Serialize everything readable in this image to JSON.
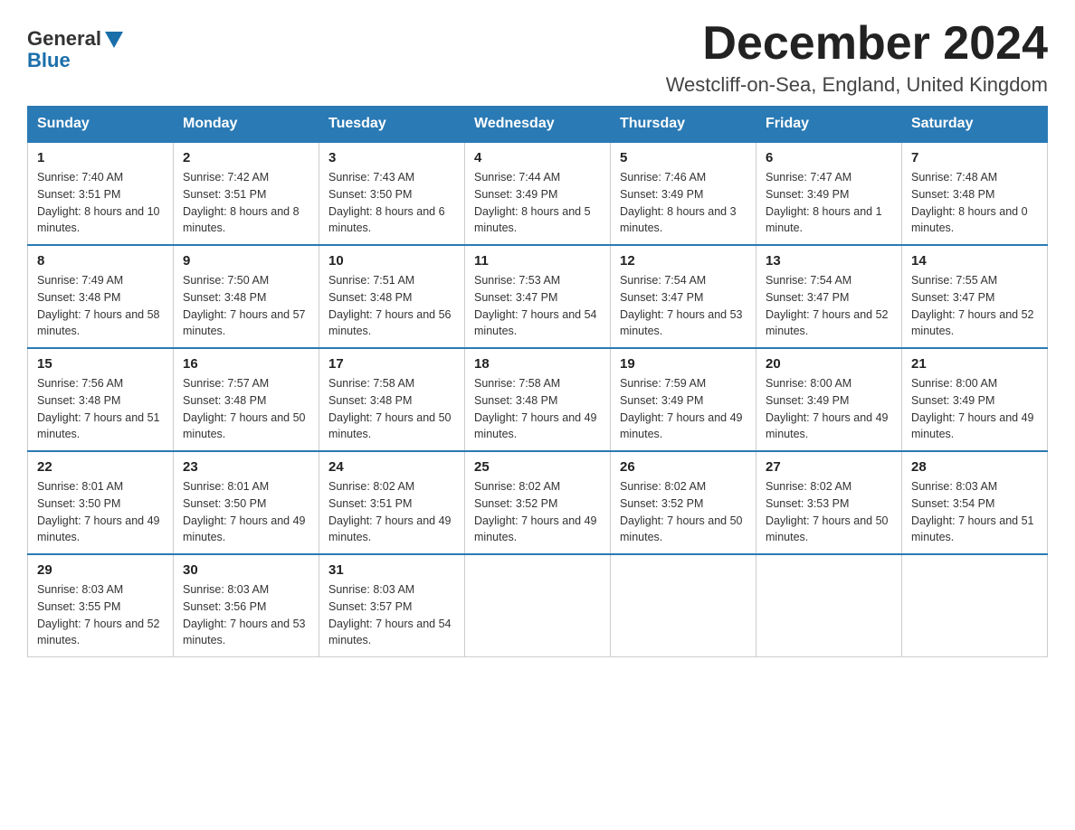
{
  "header": {
    "logo_general": "General",
    "logo_blue": "Blue",
    "month_title": "December 2024",
    "location": "Westcliff-on-Sea, England, United Kingdom"
  },
  "days_of_week": [
    "Sunday",
    "Monday",
    "Tuesday",
    "Wednesday",
    "Thursday",
    "Friday",
    "Saturday"
  ],
  "weeks": [
    [
      {
        "day": "1",
        "sunrise": "7:40 AM",
        "sunset": "3:51 PM",
        "daylight": "8 hours and 10 minutes."
      },
      {
        "day": "2",
        "sunrise": "7:42 AM",
        "sunset": "3:51 PM",
        "daylight": "8 hours and 8 minutes."
      },
      {
        "day": "3",
        "sunrise": "7:43 AM",
        "sunset": "3:50 PM",
        "daylight": "8 hours and 6 minutes."
      },
      {
        "day": "4",
        "sunrise": "7:44 AM",
        "sunset": "3:49 PM",
        "daylight": "8 hours and 5 minutes."
      },
      {
        "day": "5",
        "sunrise": "7:46 AM",
        "sunset": "3:49 PM",
        "daylight": "8 hours and 3 minutes."
      },
      {
        "day": "6",
        "sunrise": "7:47 AM",
        "sunset": "3:49 PM",
        "daylight": "8 hours and 1 minute."
      },
      {
        "day": "7",
        "sunrise": "7:48 AM",
        "sunset": "3:48 PM",
        "daylight": "8 hours and 0 minutes."
      }
    ],
    [
      {
        "day": "8",
        "sunrise": "7:49 AM",
        "sunset": "3:48 PM",
        "daylight": "7 hours and 58 minutes."
      },
      {
        "day": "9",
        "sunrise": "7:50 AM",
        "sunset": "3:48 PM",
        "daylight": "7 hours and 57 minutes."
      },
      {
        "day": "10",
        "sunrise": "7:51 AM",
        "sunset": "3:48 PM",
        "daylight": "7 hours and 56 minutes."
      },
      {
        "day": "11",
        "sunrise": "7:53 AM",
        "sunset": "3:47 PM",
        "daylight": "7 hours and 54 minutes."
      },
      {
        "day": "12",
        "sunrise": "7:54 AM",
        "sunset": "3:47 PM",
        "daylight": "7 hours and 53 minutes."
      },
      {
        "day": "13",
        "sunrise": "7:54 AM",
        "sunset": "3:47 PM",
        "daylight": "7 hours and 52 minutes."
      },
      {
        "day": "14",
        "sunrise": "7:55 AM",
        "sunset": "3:47 PM",
        "daylight": "7 hours and 52 minutes."
      }
    ],
    [
      {
        "day": "15",
        "sunrise": "7:56 AM",
        "sunset": "3:48 PM",
        "daylight": "7 hours and 51 minutes."
      },
      {
        "day": "16",
        "sunrise": "7:57 AM",
        "sunset": "3:48 PM",
        "daylight": "7 hours and 50 minutes."
      },
      {
        "day": "17",
        "sunrise": "7:58 AM",
        "sunset": "3:48 PM",
        "daylight": "7 hours and 50 minutes."
      },
      {
        "day": "18",
        "sunrise": "7:58 AM",
        "sunset": "3:48 PM",
        "daylight": "7 hours and 49 minutes."
      },
      {
        "day": "19",
        "sunrise": "7:59 AM",
        "sunset": "3:49 PM",
        "daylight": "7 hours and 49 minutes."
      },
      {
        "day": "20",
        "sunrise": "8:00 AM",
        "sunset": "3:49 PM",
        "daylight": "7 hours and 49 minutes."
      },
      {
        "day": "21",
        "sunrise": "8:00 AM",
        "sunset": "3:49 PM",
        "daylight": "7 hours and 49 minutes."
      }
    ],
    [
      {
        "day": "22",
        "sunrise": "8:01 AM",
        "sunset": "3:50 PM",
        "daylight": "7 hours and 49 minutes."
      },
      {
        "day": "23",
        "sunrise": "8:01 AM",
        "sunset": "3:50 PM",
        "daylight": "7 hours and 49 minutes."
      },
      {
        "day": "24",
        "sunrise": "8:02 AM",
        "sunset": "3:51 PM",
        "daylight": "7 hours and 49 minutes."
      },
      {
        "day": "25",
        "sunrise": "8:02 AM",
        "sunset": "3:52 PM",
        "daylight": "7 hours and 49 minutes."
      },
      {
        "day": "26",
        "sunrise": "8:02 AM",
        "sunset": "3:52 PM",
        "daylight": "7 hours and 50 minutes."
      },
      {
        "day": "27",
        "sunrise": "8:02 AM",
        "sunset": "3:53 PM",
        "daylight": "7 hours and 50 minutes."
      },
      {
        "day": "28",
        "sunrise": "8:03 AM",
        "sunset": "3:54 PM",
        "daylight": "7 hours and 51 minutes."
      }
    ],
    [
      {
        "day": "29",
        "sunrise": "8:03 AM",
        "sunset": "3:55 PM",
        "daylight": "7 hours and 52 minutes."
      },
      {
        "day": "30",
        "sunrise": "8:03 AM",
        "sunset": "3:56 PM",
        "daylight": "7 hours and 53 minutes."
      },
      {
        "day": "31",
        "sunrise": "8:03 AM",
        "sunset": "3:57 PM",
        "daylight": "7 hours and 54 minutes."
      },
      null,
      null,
      null,
      null
    ]
  ]
}
